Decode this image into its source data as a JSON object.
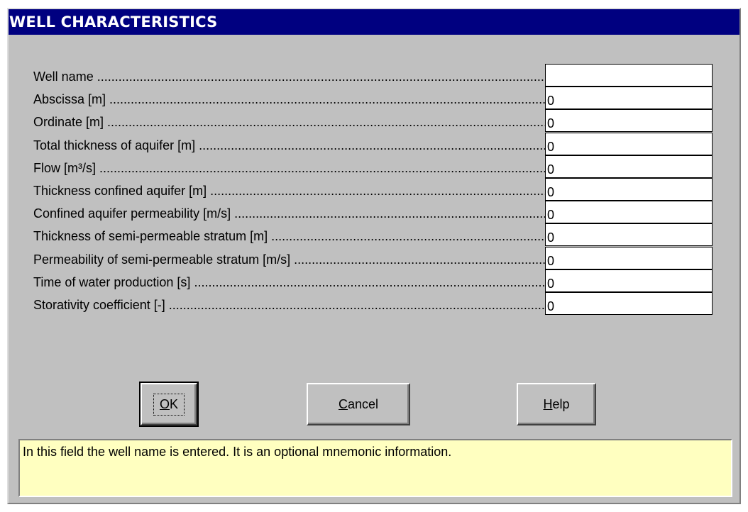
{
  "window": {
    "title": "WELL CHARACTERISTICS"
  },
  "fields": [
    {
      "label": "Well name",
      "value": ""
    },
    {
      "label": "Abscissa [m]",
      "value": "0"
    },
    {
      "label": "Ordinate [m]",
      "value": "0"
    },
    {
      "label": "Total thickness of aquifer [m]",
      "value": "0"
    },
    {
      "label": "Flow [m³/s]",
      "value": "0"
    },
    {
      "label": "Thickness confined aquifer [m]",
      "value": "0"
    },
    {
      "label": "Confined aquifer permeability [m/s]",
      "value": "0"
    },
    {
      "label": "Thickness of semi-permeable stratum [m]",
      "value": "0"
    },
    {
      "label": "Permeability of semi-permeable stratum [m/s]",
      "value": "0"
    },
    {
      "label": "Time of water production [s]",
      "value": "0"
    },
    {
      "label": "Storativity coefficient [-]",
      "value": "0"
    }
  ],
  "buttons": {
    "ok": {
      "accel": "O",
      "rest": "K"
    },
    "cancel": {
      "accel": "C",
      "rest": "ancel"
    },
    "help": {
      "accel": "H",
      "rest": "elp"
    }
  },
  "status": {
    "text": "In this field the well name is entered. It is an optional mnemonic information."
  },
  "colors": {
    "title_bar": "#000080",
    "dialog_bg": "#c0c0c0",
    "status_bg": "#ffffc0"
  }
}
